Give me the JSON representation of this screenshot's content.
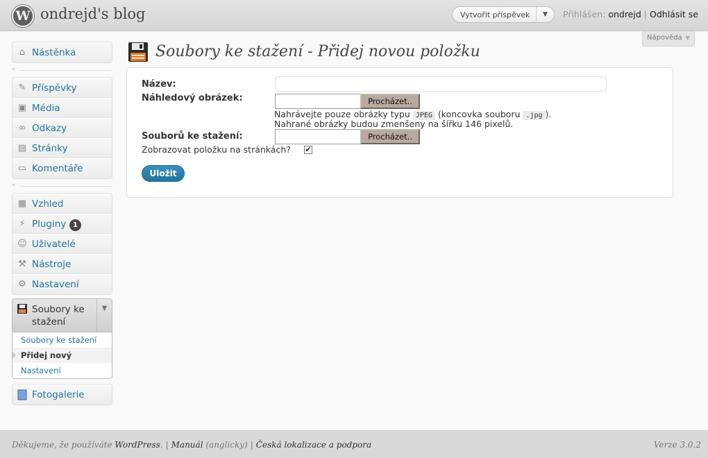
{
  "header": {
    "site_title": "ondrejd's blog",
    "favorite_action": "Vytvořit příspěvek",
    "logged_in_prefix": "Přihlášen:",
    "username": "ondrejd",
    "logout": "Odhlásit se"
  },
  "help_tab": "Nápověda",
  "menu": {
    "dashboard": "Nástěnka",
    "posts": "Příspěvky",
    "media": "Média",
    "links": "Odkazy",
    "pages": "Stránky",
    "comments": "Komentáře",
    "appearance": "Vzhled",
    "plugins": "Pluginy",
    "plugins_badge": "1",
    "users": "Uživatelé",
    "tools": "Nástroje",
    "settings": "Nastavení",
    "downloads": {
      "title": "Soubory ke stažení",
      "sub": [
        "Soubory ke stažení",
        "Přidej nový",
        "Nastavení"
      ]
    },
    "gallery": "Fotogalerie"
  },
  "page": {
    "title": "Soubory ke stažení - Přidej novou položku"
  },
  "form": {
    "name_label": "Název:",
    "name_value": "",
    "thumb_label": "Náhledový obrázek:",
    "browse_label": "Procházet..",
    "hint_line1_a": "Nahrávejte pouze obrázky typu",
    "hint_code1": "JPEG",
    "hint_line1_b": "(koncovka souboru",
    "hint_code2": ".jpg",
    "hint_line1_c": ").",
    "hint_line2": "Nahrané obrázky budou zmenšeny na šířku 146 pixelů.",
    "file_label": "Souborů ke stažení:",
    "show_label": "Zobrazovat položku na stránkách?",
    "show_checked": true,
    "save": "Uložit"
  },
  "footer": {
    "thanks_a": "Děkujeme, že používáte",
    "wordpress": "WordPress",
    "manual": "Manuál",
    "manual_note": "(anglicky)",
    "localization": "Česká lokalizace a podpora",
    "version": "Verze 3.0.2"
  }
}
